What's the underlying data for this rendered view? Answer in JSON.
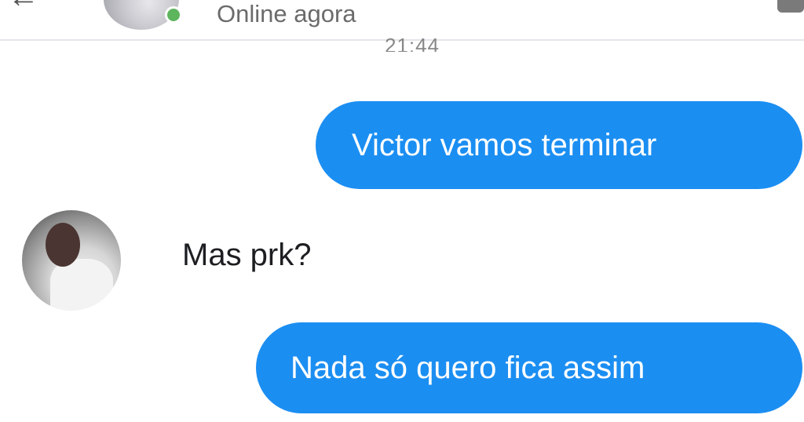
{
  "header": {
    "status": "Online agora",
    "online_color": "#5db55d",
    "back_icon": "back-arrow-icon",
    "right_icon": "video-call-icon"
  },
  "conversation": {
    "timestamp": "21:44",
    "messages": [
      {
        "direction": "outgoing",
        "text": "Victor vamos terminar"
      },
      {
        "direction": "incoming",
        "text": "Mas prk?"
      },
      {
        "direction": "outgoing",
        "text": "Nada só quero fica assim"
      }
    ]
  },
  "colors": {
    "outgoing_bubble": "#1b8ef2",
    "outgoing_text": "#ffffff",
    "incoming_text": "#1c1e21"
  }
}
